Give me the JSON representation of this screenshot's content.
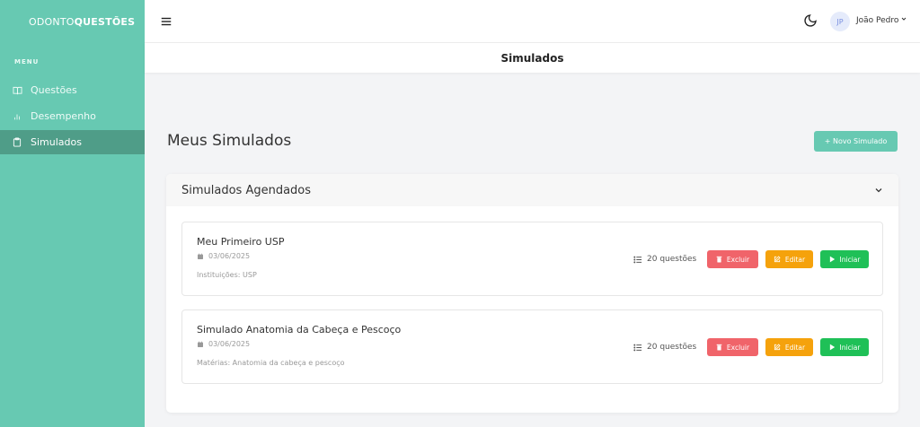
{
  "brand": {
    "part1": "ODONTO",
    "part2": "QUESTÕES"
  },
  "sidebar": {
    "menu_title": "MENU",
    "items": [
      {
        "label": "Questões",
        "icon": "book-icon"
      },
      {
        "label": "Desempenho",
        "icon": "bar-chart-icon"
      },
      {
        "label": "Simulados",
        "icon": "clipboard-icon",
        "active": true
      }
    ]
  },
  "topbar": {
    "user_initials": "JP",
    "user_name": "João Pedro"
  },
  "page": {
    "title": "Simulados",
    "heading": "Meus Simulados",
    "new_button": "+ Novo Simulado"
  },
  "section": {
    "title": "Simulados Agendados",
    "simulados": [
      {
        "title": "Meu Primeiro USP",
        "date": "03/06/2025",
        "meta": "Instituições: USP",
        "count": "20 questões"
      },
      {
        "title": "Simulado Anatomia da Cabeça e Pescoço",
        "date": "03/06/2025",
        "meta": "Matérias: Anatomia da cabeça e pescoço",
        "count": "20 questões"
      }
    ],
    "actions": {
      "delete": "Excluir",
      "edit": "Editar",
      "start": "Iniciar"
    }
  },
  "colors": {
    "brand": "#67c9b2",
    "active_menu": "#4f9d88",
    "delete": "#f0646a",
    "edit": "#f5a20c",
    "start": "#1fc057"
  }
}
